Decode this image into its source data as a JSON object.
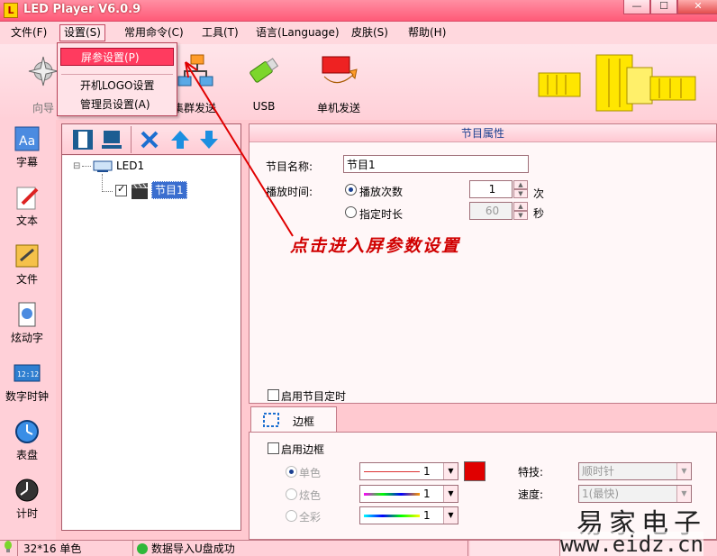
{
  "app": {
    "title": "LED Player V6.0.9",
    "icon_letter": "L"
  },
  "window_controls": {
    "minimize": "—",
    "maximize": "☐",
    "close": "✕"
  },
  "menu": [
    "文件(F)",
    "设置(S)",
    "常用命令(C)",
    "工具(T)",
    "语言(Language)",
    "皮肤(S)",
    "帮助(H)"
  ],
  "dropdown": {
    "items": [
      "屏参设置(P)",
      "开机LOGO设置",
      "管理员设置(A)"
    ]
  },
  "toolbar": {
    "buttons": [
      "向导",
      "集群发送",
      "USB",
      "单机发送"
    ]
  },
  "sidebar": {
    "items": [
      "字幕",
      "文本",
      "文件",
      "炫动字",
      "数字时钟",
      "表盘",
      "计时"
    ]
  },
  "tree": {
    "root": "LED1",
    "child": "节目1",
    "expander": "⊟"
  },
  "program_props": {
    "header": "节目属性",
    "name_label": "节目名称:",
    "name_value": "节目1",
    "play_time_label": "播放时间:",
    "play_count_label": "播放次数",
    "play_count_value": "1",
    "play_count_unit": "次",
    "duration_label": "指定时长",
    "duration_value": "60",
    "duration_unit": "秒",
    "timer_label": "启用节目定时"
  },
  "border": {
    "tab_label": "边框",
    "enable_label": "启用边框",
    "single_color_label": "单色",
    "dazzle_label": "炫色",
    "full_color_label": "全彩",
    "single_value": "1",
    "dazzle_value": "1",
    "full_value": "1",
    "effect_label": "特技:",
    "effect_value": "顺时针",
    "speed_label": "速度:",
    "speed_value": "1(最快)",
    "swatch_color": "#e00000"
  },
  "annotation": "点击进入屏参数设置",
  "watermark": {
    "line1": "易家电子",
    "line2": "www.eidz.cn"
  },
  "status": {
    "size": "32*16 单色",
    "message": "数据导入U盘成功"
  },
  "colors": {
    "accent": "#ff3b5f",
    "annotation": "#d00000"
  }
}
